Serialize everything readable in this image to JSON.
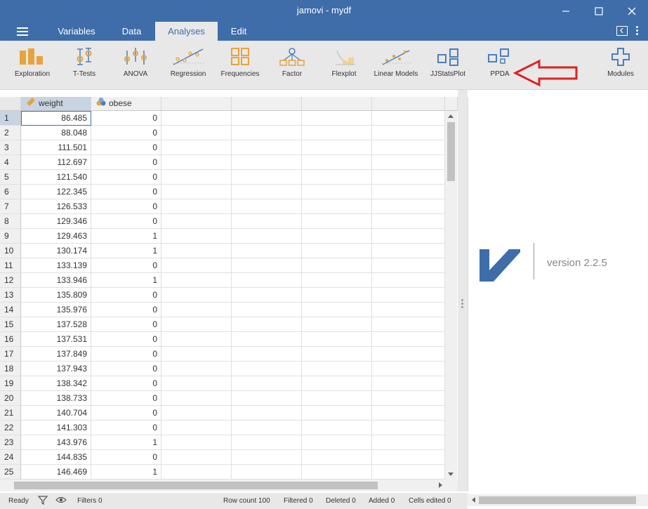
{
  "window": {
    "title": "jamovi - mydf"
  },
  "menu": {
    "tabs": [
      {
        "label": "Variables"
      },
      {
        "label": "Data"
      },
      {
        "label": "Analyses"
      },
      {
        "label": "Edit"
      }
    ]
  },
  "ribbon": {
    "items": [
      {
        "label": "Exploration",
        "icon": "exploration-icon"
      },
      {
        "label": "T-Tests",
        "icon": "t-tests-icon"
      },
      {
        "label": "ANOVA",
        "icon": "anova-icon"
      },
      {
        "label": "Regression",
        "icon": "regression-icon"
      },
      {
        "label": "Frequencies",
        "icon": "frequencies-icon"
      },
      {
        "label": "Factor",
        "icon": "factor-icon"
      },
      {
        "label": "Flexplot",
        "icon": "flexplot-icon"
      },
      {
        "label": "Linear Models",
        "icon": "linear-models-icon"
      },
      {
        "label": "JJStatsPlot",
        "icon": "jjstatsplot-icon"
      },
      {
        "label": "PPDA",
        "icon": "ppda-icon"
      },
      {
        "label": "Modules",
        "icon": "modules-icon"
      }
    ]
  },
  "sheet": {
    "columns": [
      {
        "name": "weight",
        "icon": "continuous-ruler-icon"
      },
      {
        "name": "obese",
        "icon": "nominal-circles-icon"
      }
    ],
    "rows": [
      {
        "n": "1",
        "weight": "86.485",
        "obese": "0"
      },
      {
        "n": "2",
        "weight": "88.048",
        "obese": "0"
      },
      {
        "n": "3",
        "weight": "111.501",
        "obese": "0"
      },
      {
        "n": "4",
        "weight": "112.697",
        "obese": "0"
      },
      {
        "n": "5",
        "weight": "121.540",
        "obese": "0"
      },
      {
        "n": "6",
        "weight": "122.345",
        "obese": "0"
      },
      {
        "n": "7",
        "weight": "126.533",
        "obese": "0"
      },
      {
        "n": "8",
        "weight": "129.346",
        "obese": "0"
      },
      {
        "n": "9",
        "weight": "129.463",
        "obese": "1"
      },
      {
        "n": "10",
        "weight": "130.174",
        "obese": "1"
      },
      {
        "n": "11",
        "weight": "133.139",
        "obese": "0"
      },
      {
        "n": "12",
        "weight": "133.946",
        "obese": "1"
      },
      {
        "n": "13",
        "weight": "135.809",
        "obese": "0"
      },
      {
        "n": "14",
        "weight": "135.976",
        "obese": "0"
      },
      {
        "n": "15",
        "weight": "137.528",
        "obese": "0"
      },
      {
        "n": "16",
        "weight": "137.531",
        "obese": "0"
      },
      {
        "n": "17",
        "weight": "137.849",
        "obese": "0"
      },
      {
        "n": "18",
        "weight": "137.943",
        "obese": "0"
      },
      {
        "n": "19",
        "weight": "138.342",
        "obese": "0"
      },
      {
        "n": "20",
        "weight": "138.733",
        "obese": "0"
      },
      {
        "n": "21",
        "weight": "140.704",
        "obese": "0"
      },
      {
        "n": "22",
        "weight": "141.303",
        "obese": "0"
      },
      {
        "n": "23",
        "weight": "143.976",
        "obese": "1"
      },
      {
        "n": "24",
        "weight": "144.835",
        "obese": "0"
      },
      {
        "n": "25",
        "weight": "146.469",
        "obese": "1"
      }
    ]
  },
  "results": {
    "version": "version 2.2.5"
  },
  "status": {
    "ready": "Ready",
    "filters": "Filters 0",
    "row_count": "Row count 100",
    "filtered": "Filtered 0",
    "deleted": "Deleted 0",
    "added": "Added 0",
    "cells_edited": "Cells edited 0"
  },
  "colors": {
    "brand": "#3e6da9",
    "ribbon_icon": "#e8a33c",
    "ribbon_icon_blue": "#4a7ebb",
    "annotation": "#e02020"
  }
}
